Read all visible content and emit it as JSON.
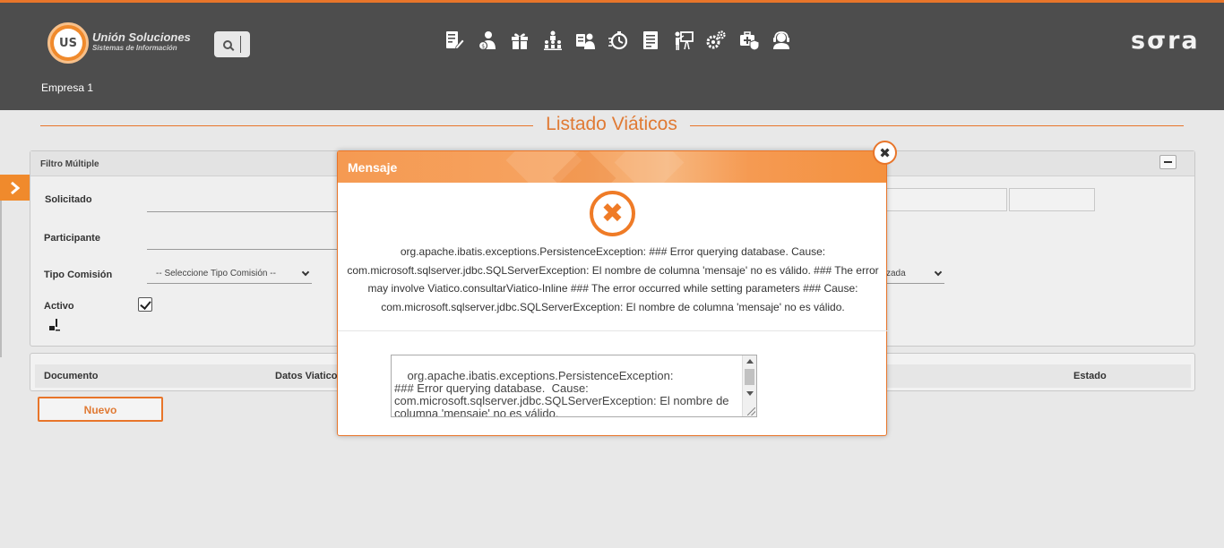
{
  "header": {
    "logo_title": "Unión Soluciones",
    "logo_subtitle": "Sistemas de Información",
    "logo_mark": "US",
    "brand": "sσra",
    "company": "Empresa 1",
    "nav_icons": [
      "edit-document-icon",
      "user-money-icon",
      "gift-icon",
      "org-chart-icon",
      "id-card-user-icon",
      "stopwatch-icon",
      "document-list-icon",
      "presentation-icon",
      "gears-icon",
      "medical-kit-shield-icon",
      "support-agent-icon"
    ]
  },
  "page": {
    "title": "Listado Viáticos"
  },
  "filter": {
    "heading": "Filtro Múltiple",
    "label_solicitado": "Solicitado",
    "label_participante": "Participante",
    "label_tipo_comision": "Tipo Comisión",
    "tipo_comision_value": "-- Seleccione Tipo Comisión --",
    "label_activo": "Activo",
    "activo_checked": true,
    "right_select_value": "zada"
  },
  "table": {
    "columns": [
      "Documento",
      "Datos Viatico",
      "Estado"
    ]
  },
  "buttons": {
    "nuevo": "Nuevo"
  },
  "modal": {
    "title": "Mensaje",
    "close_glyph": "✖",
    "icon_glyph": "✖",
    "message": "org.apache.ibatis.exceptions.PersistenceException: ### Error querying database. Cause: com.microsoft.sqlserver.jdbc.SQLServerException: El nombre de columna 'mensaje' no es válido. ### The error may involve Viatico.consultarViatico-Inline ### The error occurred while setting parameters ### Cause: com.microsoft.sqlserver.jdbc.SQLServerException: El nombre de columna 'mensaje' no es válido.",
    "detail": "org.apache.ibatis.exceptions.PersistenceException: \n### Error querying database.  Cause: com.microsoft.sqlserver.jdbc.SQLServerException: El nombre de columna 'mensaje' no es válido."
  },
  "colors": {
    "accent": "#e8752a",
    "header_bg": "#4d4d4d",
    "page_bg": "#e8e8e8"
  }
}
